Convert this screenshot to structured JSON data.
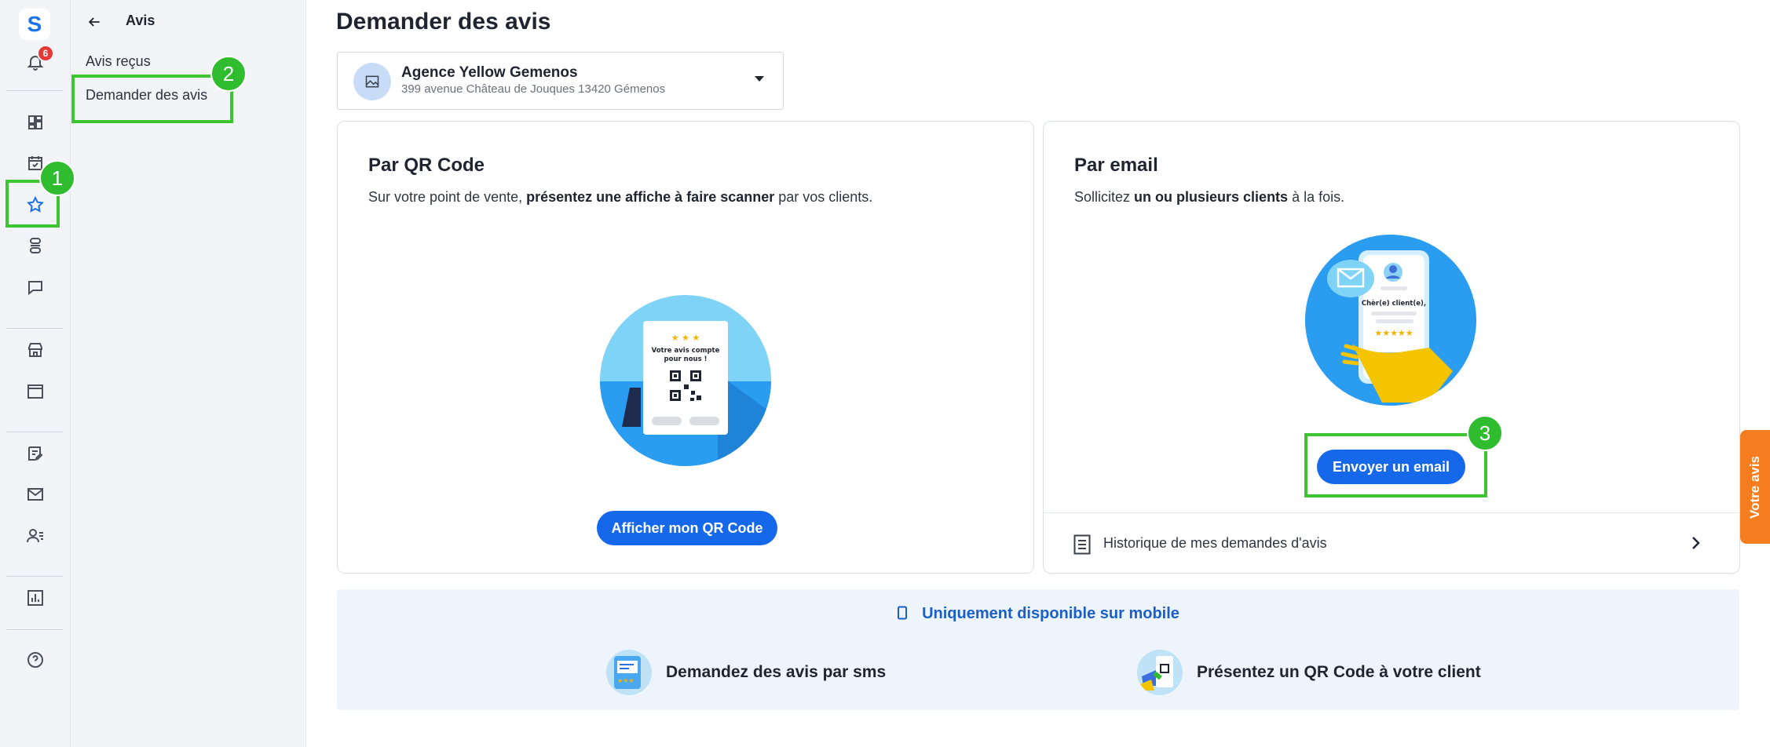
{
  "app": {
    "logo_letter": "S",
    "notification_count": "6"
  },
  "submenu": {
    "title": "Avis",
    "items": [
      {
        "label": "Avis reçus"
      },
      {
        "label": "Demander des avis"
      }
    ]
  },
  "annotations": [
    "1",
    "2",
    "3"
  ],
  "page": {
    "title": "Demander des avis"
  },
  "store": {
    "name": "Agence Yellow Gemenos",
    "address": "399 avenue Château de Jouques 13420 Gémenos"
  },
  "qr_card": {
    "title": "Par QR Code",
    "desc_prefix": "Sur votre point de vente, ",
    "desc_bold": "présentez une affiche à faire scanner",
    "desc_suffix": " par vos clients.",
    "poster_text_1": "Votre avis compte",
    "poster_text_2": "pour nous !",
    "button": "Afficher mon QR Code"
  },
  "email_card": {
    "title": "Par email",
    "desc_prefix": "Sollicitez ",
    "desc_bold": "un ou plusieurs clients",
    "desc_suffix": " à la fois.",
    "phone_text": "Chèr(e) client(e),",
    "button": "Envoyer un email",
    "history_label": "Historique de mes demandes d'avis"
  },
  "mobile": {
    "heading": "Uniquement disponible sur mobile",
    "option_sms": "Demandez des avis par sms",
    "option_qr": "Présentez un QR Code à votre client"
  },
  "side_tab": {
    "label": "Votre avis"
  },
  "colors": {
    "primary": "#1668ea",
    "highlight": "#3cc431",
    "side_tab": "#f57c1f",
    "badge": "#e53935"
  }
}
